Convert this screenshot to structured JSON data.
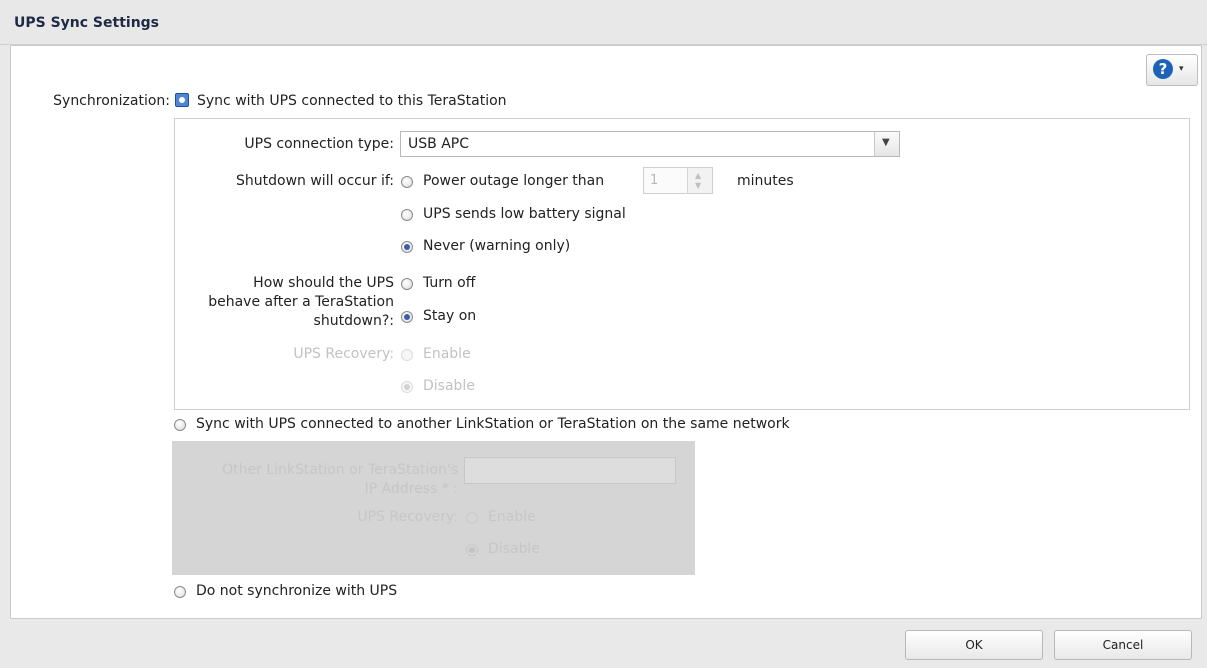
{
  "window": {
    "title": "UPS Sync Settings"
  },
  "help": {
    "glyph": "?",
    "caret": "▾"
  },
  "sync": {
    "label": "Synchronization:",
    "option_local": "Sync with UPS connected to this TeraStation",
    "option_network": "Sync with UPS connected to another LinkStation or TeraStation on the same network",
    "option_none": "Do not synchronize with UPS",
    "selected": "option_local"
  },
  "local": {
    "connection_label": "UPS connection type:",
    "connection_value": "USB APC",
    "shutdown_label": "Shutdown will occur if:",
    "outage_label": "Power outage longer than",
    "outage_value": "1",
    "minutes_label": "minutes",
    "low_battery_label": "UPS sends low battery signal",
    "never_label": "Never (warning only)",
    "shutdown_selected": "never",
    "behave_label_1": "How should the UPS",
    "behave_label_2": "behave after a TeraStation",
    "behave_label_3": "shutdown?:",
    "turn_off_label": "Turn off",
    "stay_on_label": "Stay on",
    "behave_selected": "stay_on",
    "recovery_label": "UPS Recovery:",
    "enable_label": "Enable",
    "disable_label": "Disable"
  },
  "network": {
    "ip_label_1": "Other LinkStation or TeraStation's",
    "ip_label_2": "IP Address * :",
    "recovery_label": "UPS Recovery:",
    "enable_label": "Enable",
    "disable_label": "Disable"
  },
  "footer": {
    "ok_label": "OK",
    "cancel_label": "Cancel"
  }
}
